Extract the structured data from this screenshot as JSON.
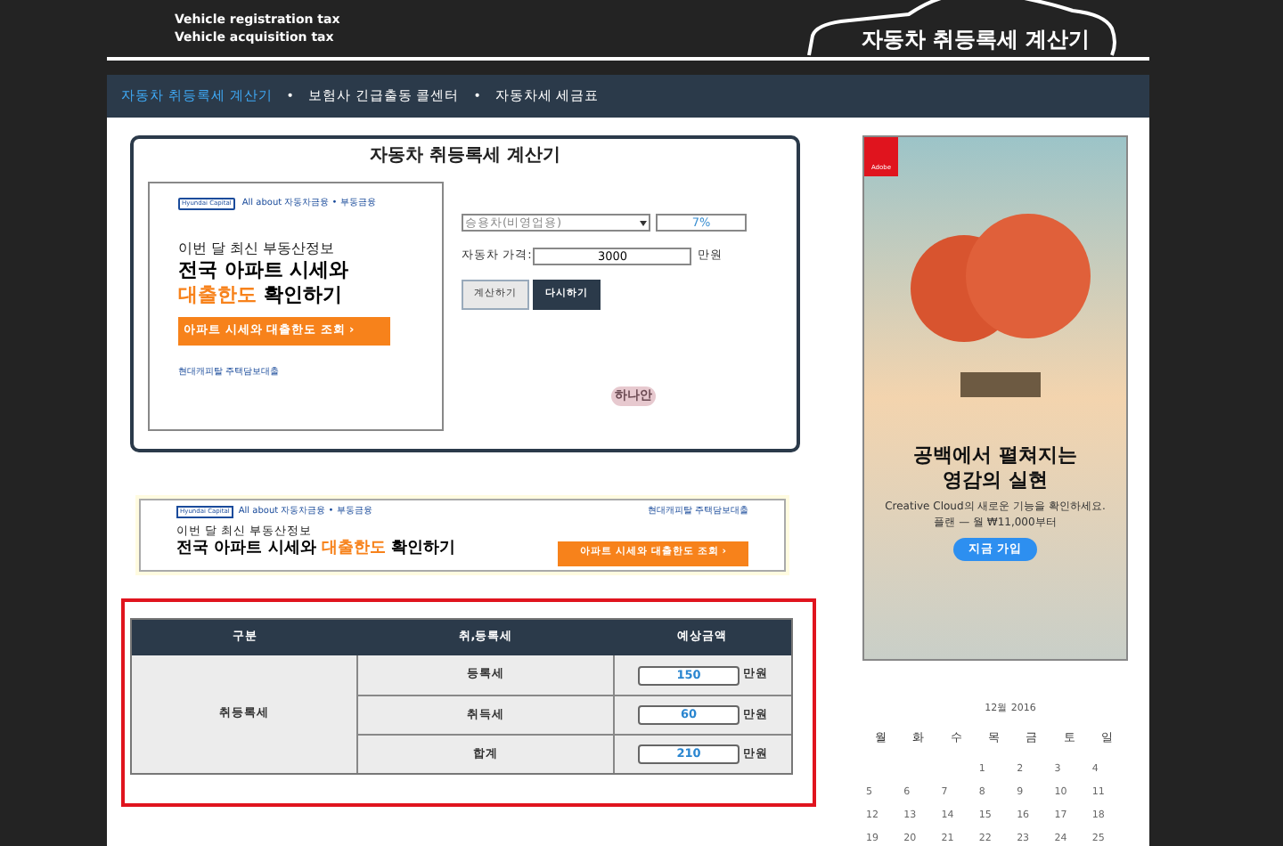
{
  "header": {
    "subtitles": [
      "Vehicle registration tax",
      "Vehicle acquisition tax"
    ],
    "title": "자동차 취등록세 계산기"
  },
  "nav": [
    {
      "label": "자동차 취등록세 계산기",
      "selected": true
    },
    {
      "label": "보험사 긴급출동 콜센터",
      "selected": false
    },
    {
      "label": "자동차세 세금표",
      "selected": false
    }
  ],
  "nav_separator": "•",
  "calculator": {
    "title": "자동차 취등록세 계산기",
    "ad": {
      "brand": "Hyundai Capital",
      "tagline": "All about 자동차금융 • 부동금융",
      "line1": "이번 달 최신 부동산정보",
      "line2": "전국 아파트 시세와",
      "highlight": "대출한도",
      "line3": " 확인하기",
      "cta": "아파트 시세와 대출한도 조회 ›",
      "footer": "현대캐피탈 주택담보대출"
    },
    "car_type": "승용차(비영업용)",
    "rate": "7%",
    "price_label": "자동차 가격:",
    "price": "3000",
    "unit": "만원",
    "buttons": [
      {
        "label": "계산하기",
        "kind": "light"
      },
      {
        "label": "다시하기",
        "kind": "dark"
      }
    ],
    "sticker": "하나안"
  },
  "banner_ad": {
    "brand": "Hyundai Capital",
    "tagline": "All about 자동차금융 • 부동금융",
    "sponsor": "현대캐피탈 주택담보대출",
    "line1": "이번 달 최신 부동산정보",
    "line2": "전국 아파트 시세와 ",
    "highlight": "대출한도",
    "line3": " 확인하기",
    "cta": "아파트 시세와 대출한도 조회 ›"
  },
  "result_table": {
    "columns": [
      "구분",
      "취,등록세",
      "예상금액"
    ],
    "group": "취등록세",
    "rows": [
      {
        "name": "등록세",
        "amount": "150",
        "unit": "만원"
      },
      {
        "name": "취득세",
        "amount": "60",
        "unit": "만원"
      },
      {
        "name": "합계",
        "amount": "210",
        "unit": "만원"
      }
    ]
  },
  "side_ad": {
    "logo": "Adobe",
    "headline1": "공백에서 펼쳐지는",
    "headline2": "영감의 실현",
    "body": "Creative Cloud의 새로운 기능을 확인하세요.",
    "price": "플랜 — 월 ₩11,000부터",
    "cta": "지금 가입"
  },
  "calendar": {
    "title": "12월 2016",
    "weekdays": [
      "월",
      "화",
      "수",
      "목",
      "금",
      "토",
      "일"
    ],
    "weeks": [
      [
        "1",
        "2",
        "3",
        "4"
      ],
      [
        "5",
        "6",
        "7",
        "8",
        "9",
        "10",
        "11"
      ],
      [
        "12",
        "13",
        "14",
        "15",
        "16",
        "17",
        "18"
      ],
      [
        "19",
        "20",
        "21",
        "22",
        "23",
        "24",
        "25"
      ]
    ]
  }
}
